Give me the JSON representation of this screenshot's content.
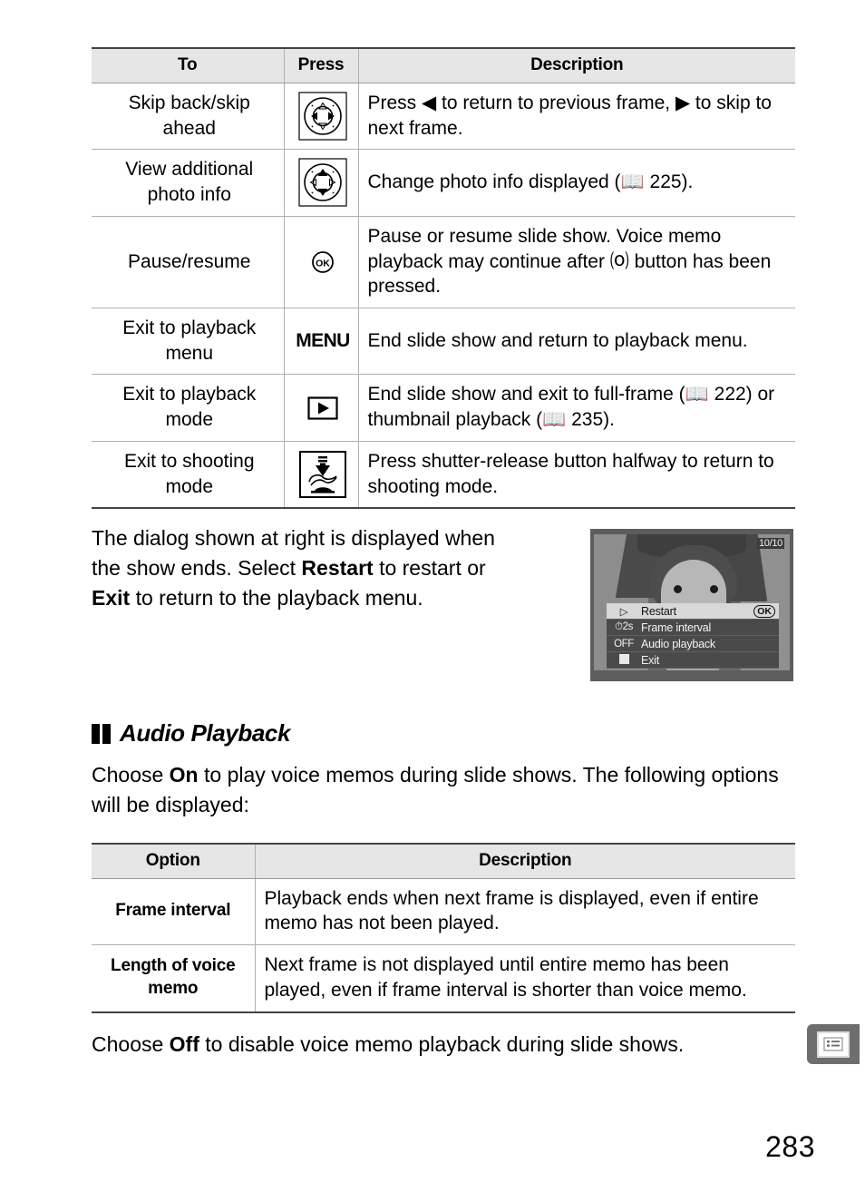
{
  "page": {
    "number": "283",
    "thumb_tab_icon": "menu-list-icon"
  },
  "table_controls": {
    "headers": {
      "to": "To",
      "press": "Press",
      "description": "Description"
    },
    "rows": [
      {
        "to": "Skip back/skip ahead",
        "press_icon": "multi-selector-left-right-icon",
        "description": "Press ◀ to return to previous frame, ▶ to skip to next frame."
      },
      {
        "to": "View additional photo info",
        "press_icon": "multi-selector-up-down-icon",
        "description": "Change photo info displayed (📖 225)."
      },
      {
        "to": "Pause/resume",
        "press_icon": "ok-button-icon",
        "description": "Pause or resume slide show. Voice memo playback may continue after ⒪ button has been pressed."
      },
      {
        "to": "Exit to playback menu",
        "press_icon": "menu-button-icon",
        "press_label": "MENU",
        "description": "End slide show and return to playback menu."
      },
      {
        "to": "Exit to playback mode",
        "press_icon": "playback-button-icon",
        "description": "End slide show and exit to full-frame (📖 222) or thumbnail playback (📖 235)."
      },
      {
        "to": "Exit to shooting mode",
        "press_icon": "shutter-release-halfway-icon",
        "description": "Press shutter-release button halfway to return to shooting mode."
      }
    ]
  },
  "intro": {
    "line1": "The dialog shown at right is displayed when",
    "line2_pre": "the show ends.  Select ",
    "line2_bold": "Restart",
    "line2_post": " to restart or",
    "line3_bold": "Exit",
    "line3_post": " to return to the playback menu."
  },
  "lcd": {
    "frame_counter": "10/10",
    "menu_items": [
      {
        "icon": "▷",
        "label": "Restart",
        "right": "OK",
        "selected": true
      },
      {
        "icon": "2s",
        "label": "Frame interval",
        "right": "",
        "selected": false
      },
      {
        "icon": "OFF",
        "label": "Audio playback",
        "right": "",
        "selected": false
      },
      {
        "icon": "■",
        "label": "Exit",
        "right": "",
        "selected": false
      }
    ]
  },
  "section": {
    "title": "Audio Playback",
    "body_pre": "Choose ",
    "body_bold": "On",
    "body_post": " to play voice memos during slide shows.  The following options will be displayed:"
  },
  "table_options": {
    "headers": {
      "option": "Option",
      "description": "Description"
    },
    "rows": [
      {
        "option": "Frame interval",
        "description": "Playback ends when next frame is displayed, even if entire memo has not been played."
      },
      {
        "option": "Length of voice memo",
        "description": "Next frame is not displayed until entire memo has been played, even if frame interval is shorter than voice memo."
      }
    ]
  },
  "closing": {
    "pre": "Choose ",
    "bold": "Off",
    "post": " to disable voice memo playback during slide shows."
  }
}
